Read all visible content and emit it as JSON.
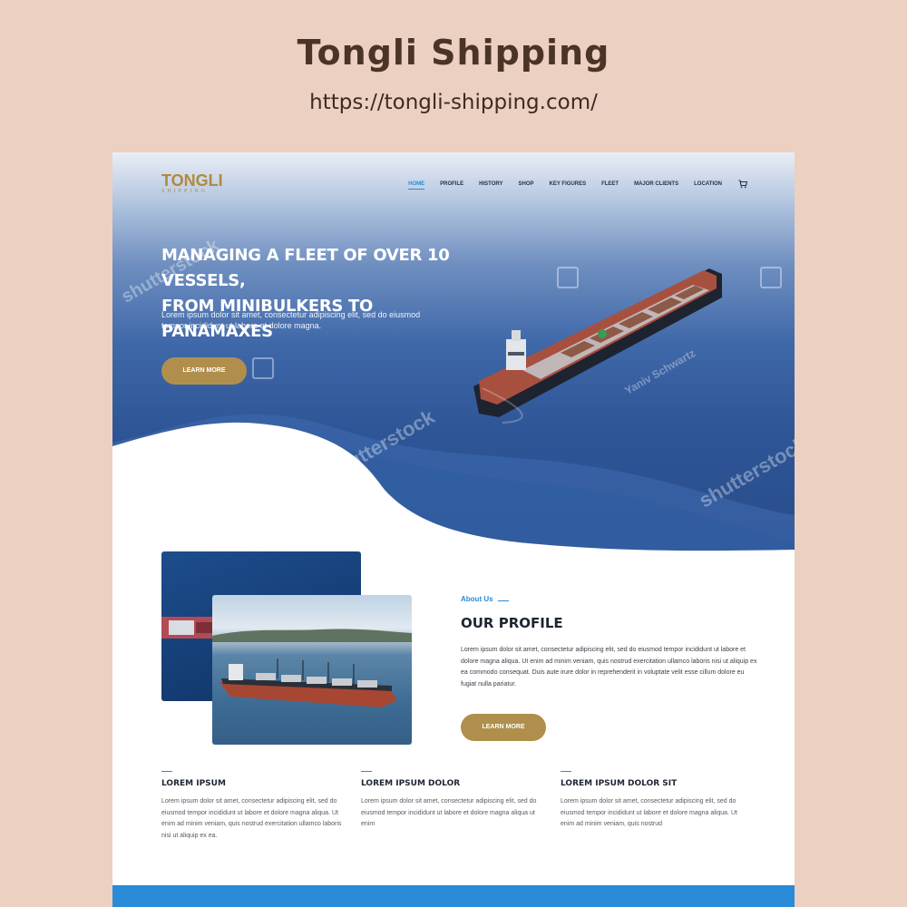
{
  "header": {
    "title": "Tongli Shipping",
    "url": "https://tongli-shipping.com/"
  },
  "site": {
    "logo": {
      "main": "TONGLI",
      "sub": "SHIPPING"
    },
    "nav": [
      {
        "label": "HOME",
        "active": true
      },
      {
        "label": "PROFILE",
        "active": false
      },
      {
        "label": "HISTORY",
        "active": false
      },
      {
        "label": "SHOP",
        "active": false
      },
      {
        "label": "KEY FIGURES",
        "active": false
      },
      {
        "label": "FLEET",
        "active": false
      },
      {
        "label": "MAJOR CLIENTS",
        "active": false
      },
      {
        "label": "LOCATION",
        "active": false
      }
    ],
    "cart_icon": "cart-icon",
    "hero": {
      "title_line1": "MANAGING A FLEET OF OVER 10 VESSELS,",
      "title_line2": "FROM MINIBULKERS TO PANAMAXES",
      "text": "Lorem ipsum dolor sit amet, consectetur adipiscing elit, sed do eiusmod tempor incididunt ut labore et dolore magna.",
      "button": "LEARN MORE"
    },
    "watermarks": {
      "brand": "shutterstock",
      "author": "Yaniv Schwartz"
    },
    "about": {
      "tag": "About Us",
      "title": "OUR PROFILE",
      "text": "Lorem ipsum dolor sit amet, consectetur adipiscing elit, sed do eiusmod tempor incididunt ut labore et dolore magna aliqua. Ut enim ad minim veniam, quis nostrud exercitation ullamco laboris nisi ut aliquip ex ea commodo consequat. Duis aute irure dolor in reprehenderit in voluptate velit esse cillum dolore eu fugiat nulla pariatur.",
      "button": "LEARN MORE"
    },
    "features": [
      {
        "title": "LOREM IPSUM",
        "text": "Lorem ipsum dolor sit amet, consectetur adipiscing elit, sed do eiusmod tempor incididunt ut labore et dolore magna aliqua. Ut enim ad minim veniam, quis nostrud exercitation ullamco laboris nisi ut aliquip ex ea."
      },
      {
        "title": "LOREM IPSUM DOLOR",
        "text": "Lorem ipsum dolor sit amet, consectetur adipiscing elit, sed do eiusmod tempor incididunt ut labore et dolore magna aliqua ut enim"
      },
      {
        "title": "LOREM IPSUM DOLOR SIT",
        "text": "Lorem ipsum dolor sit amet, consectetur adipiscing elit, sed do eiusmod tempor incididunt ut labore et dolore magna aliqua. Ut enim ad minim veniam, quis nostrud"
      }
    ]
  },
  "colors": {
    "background": "#ecd0c2",
    "gold": "#b08f4c",
    "accent_blue": "#2a8bd8",
    "title_brown": "#4a3426"
  }
}
